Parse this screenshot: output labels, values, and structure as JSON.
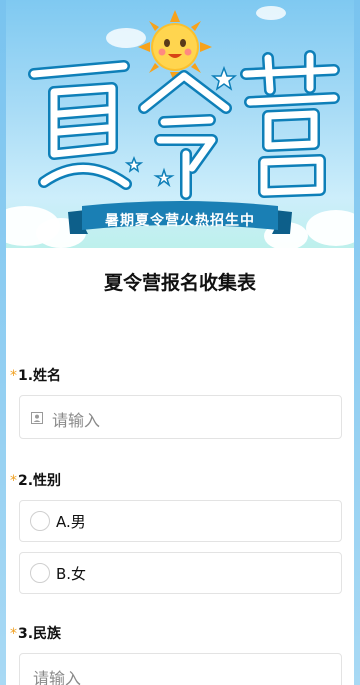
{
  "banner": {
    "title_art": "夏令营",
    "ribbon_text": "暑期夏令营火热招生中"
  },
  "form": {
    "title": "夏令营报名收集表",
    "required_mark": "*",
    "questions": [
      {
        "label": "1.姓名",
        "type": "input",
        "placeholder": "请输入",
        "icon": "person-icon"
      },
      {
        "label": "2.性别",
        "type": "radio",
        "options": [
          "A.男",
          "B.女"
        ]
      },
      {
        "label": "3.民族",
        "type": "input",
        "placeholder": "请输入"
      }
    ]
  },
  "colors": {
    "required": "#f0a020",
    "ribbon": "#1a7fb4",
    "title_art_fill": "#ffffff",
    "title_art_outline": "#0e7fb8"
  }
}
